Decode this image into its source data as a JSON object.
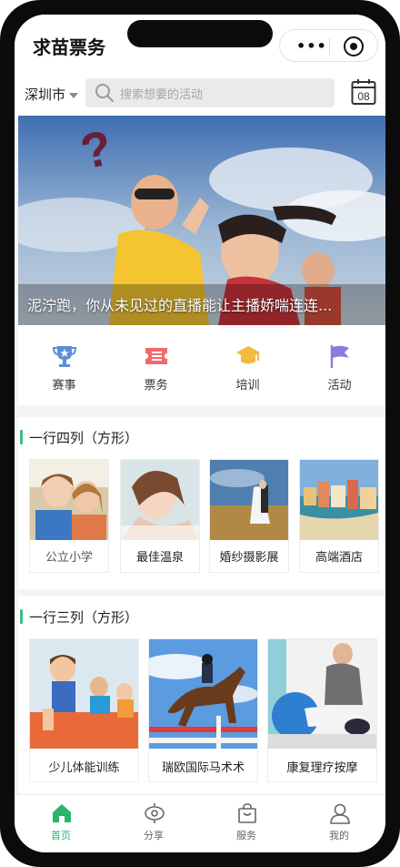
{
  "header": {
    "app_title": "求苗票务",
    "more_label": "•••"
  },
  "search": {
    "city": "深圳市",
    "placeholder": "搜索想要的活动",
    "calendar_day": "08"
  },
  "banner": {
    "caption": "泥泞跑，你从未见过的直播能让主播娇喘连连..."
  },
  "categories": [
    {
      "label": "赛事",
      "icon": "trophy-icon",
      "color": "#5b8fd8"
    },
    {
      "label": "票务",
      "icon": "ticket-icon",
      "color": "#f36a6a"
    },
    {
      "label": "培训",
      "icon": "graduation-cap-icon",
      "color": "#f3b93a"
    },
    {
      "label": "活动",
      "icon": "flag-icon",
      "color": "#8b7be0"
    }
  ],
  "section_four": {
    "title": "一行四列（方形）",
    "items": [
      {
        "label": "公立小学"
      },
      {
        "label": "最佳温泉"
      },
      {
        "label": "婚纱摄影展"
      },
      {
        "label": "高端酒店"
      }
    ]
  },
  "section_three": {
    "title": "一行三列（方形）",
    "items": [
      {
        "label": "少儿体能训练"
      },
      {
        "label": "瑞欧国际马术术"
      },
      {
        "label": "康复理疗按摩"
      }
    ]
  },
  "tabbar": {
    "items": [
      {
        "label": "首页",
        "icon": "home-icon",
        "active": true
      },
      {
        "label": "分享",
        "icon": "share-icon",
        "active": false
      },
      {
        "label": "服务",
        "icon": "bag-icon",
        "active": false
      },
      {
        "label": "我的",
        "icon": "user-icon",
        "active": false
      }
    ]
  },
  "colors": {
    "accent": "#2cb36a",
    "section_marker": "#3cbf7f"
  }
}
